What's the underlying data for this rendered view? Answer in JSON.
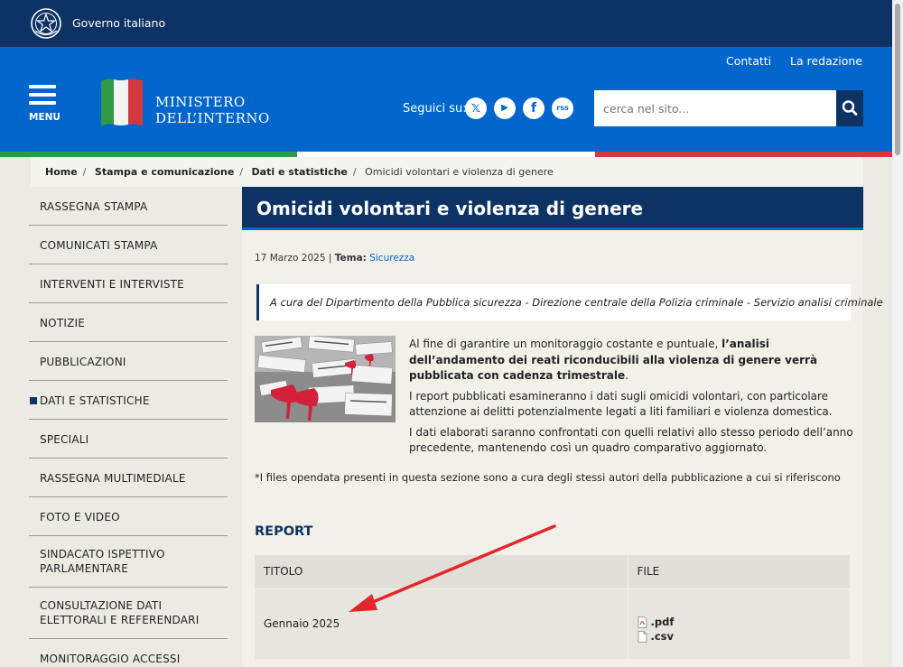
{
  "gov_bar": {
    "label": "Governo italiano"
  },
  "header": {
    "contacts": "Contatti",
    "editorial": "La redazione",
    "menu_label": "MENU",
    "ministry_line1": "MINISTERO",
    "ministry_line2": "DELL’INTERNO",
    "follow_label": "Seguici su:",
    "social": {
      "x": "𝕏",
      "youtube": "▶",
      "facebook": "f",
      "rss": "rss"
    },
    "search_placeholder": "cerca nel sito..."
  },
  "breadcrumb": {
    "items": [
      "Home",
      "Stampa e comunicazione",
      "Dati e statistiche"
    ],
    "current": "Omicidi volontari e violenza di genere"
  },
  "sidebar": {
    "items": [
      "RASSEGNA STAMPA",
      "COMUNICATI STAMPA",
      "INTERVENTI E INTERVISTE",
      "NOTIZIE",
      "PUBBLICAZIONI",
      "DATI E STATISTICHE",
      "SPECIALI",
      "RASSEGNA MULTIMEDIALE",
      "FOTO E VIDEO",
      "SINDACATO ISPETTIVO PARLAMENTARE",
      "CONSULTAZIONE DATI ELETTORALI E REFERENDARI",
      "MONITORAGGIO ACCESSI"
    ],
    "active": "DATI E STATISTICHE"
  },
  "article": {
    "title": "Omicidi volontari e violenza di genere",
    "date": "17 Marzo 2025",
    "separator": "|",
    "theme_label": "Tema:",
    "theme_value": "Sicurezza",
    "intro": "A cura del Dipartimento della Pubblica sicurezza - Direzione centrale della Polizia criminale - Servizio analisi criminale",
    "para1_pre": "Al fine di garantire un monitoraggio costante e puntuale, ",
    "para1_bold": "l’analisi dell’andamento dei reati riconducibili alla violenza di genere verrà pubblicata con cadenza trimestrale",
    "para1_post": ".",
    "para2": "I report pubblicati esamineranno i dati sugli omicidi volontari, con particolare attenzione ai delitti potenzialmente legati a liti familiari e violenza domestica.",
    "para3": "I dati elaborati saranno confrontati con quelli relativi allo stesso periodo dell’anno precedente, mantenendo così un quadro comparativo aggiornato.",
    "note": "*I files opendata presenti in questa sezione sono a cura degli stessi autori della pubblicazione a cui si riferiscono"
  },
  "report": {
    "heading": "REPORT",
    "columns": [
      "TITOLO",
      "FILE"
    ],
    "rows": [
      {
        "title": "Gennaio 2025",
        "files": [
          ".pdf",
          ".csv"
        ]
      }
    ]
  },
  "colors": {
    "gov_bar": "#0d3264",
    "header": "#0066cc",
    "accent_dark": "#0d3264",
    "arrow": "#e5262b"
  }
}
